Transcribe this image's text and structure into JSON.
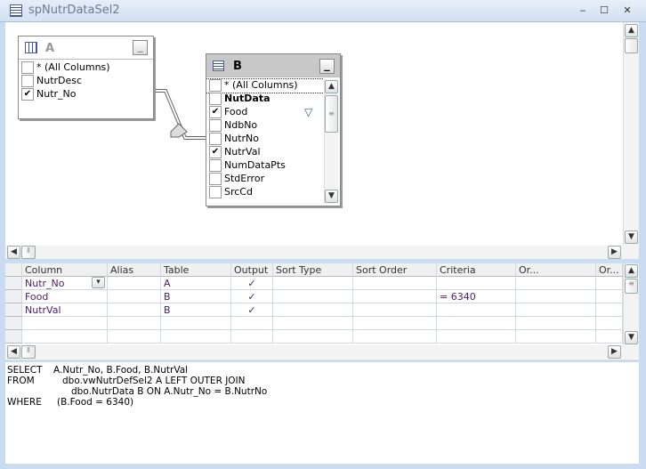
{
  "window": {
    "title": "spNutrDataSel2",
    "min": "‒",
    "max": "☐",
    "close": "✕"
  },
  "diagram": {
    "table_a": {
      "name": "A",
      "columns": [
        {
          "label": "* (All Columns)",
          "checked": false
        },
        {
          "label": "NutrDesc",
          "checked": false
        },
        {
          "label": "Nutr_No",
          "checked": true
        }
      ]
    },
    "table_b": {
      "name": "B",
      "columns": [
        {
          "label": "* (All Columns)",
          "checked": false
        },
        {
          "label": "NutData",
          "checked": false
        },
        {
          "label": "Food",
          "checked": true,
          "filter": true
        },
        {
          "label": "NdbNo",
          "checked": false
        },
        {
          "label": "NutrNo",
          "checked": false
        },
        {
          "label": "NutrVal",
          "checked": true
        },
        {
          "label": "NumDataPts",
          "checked": false
        },
        {
          "label": "StdError",
          "checked": false
        },
        {
          "label": "SrcCd",
          "checked": false
        }
      ]
    },
    "check": "✔",
    "min_label": "_"
  },
  "grid": {
    "headers": [
      "Column",
      "Alias",
      "Table",
      "Output",
      "Sort Type",
      "Sort Order",
      "Criteria",
      "Or...",
      "Or..."
    ],
    "rows": [
      {
        "column": "Nutr_No",
        "alias": "",
        "table": "A",
        "output": "✓",
        "criteria": ""
      },
      {
        "column": "Food",
        "alias": "",
        "table": "B",
        "output": "✓",
        "criteria": "= 6340"
      },
      {
        "column": "NutrVal",
        "alias": "",
        "table": "B",
        "output": "✓",
        "criteria": ""
      }
    ]
  },
  "sql": {
    "lines": [
      {
        "kw": "SELECT",
        "text": "A.Nutr_No, B.Food, B.NutrVal"
      },
      {
        "kw": "FROM",
        "text": "dbo.vwNutrDefSel2 A LEFT OUTER JOIN"
      },
      {
        "kw": "",
        "text": "dbo.NutrData B ON A.Nutr_No = B.NutrNo"
      },
      {
        "kw": "WHERE",
        "text": "(B.Food = 6340)"
      }
    ]
  }
}
